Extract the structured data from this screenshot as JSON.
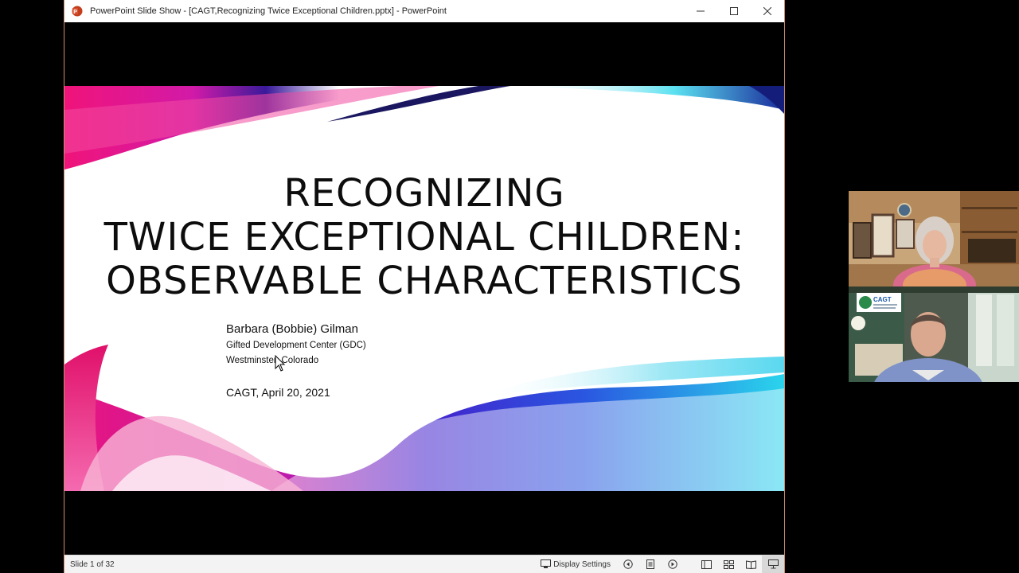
{
  "window": {
    "title": "PowerPoint Slide Show - [CAGT,Recognizing Twice Exceptional Children.pptx] - PowerPoint",
    "app_icon": "powerpoint-icon",
    "controls": [
      "minimize-icon",
      "maximize-icon",
      "close-icon"
    ]
  },
  "slide": {
    "title_lines": [
      "RECOGNIZING",
      "TWICE EXCEPTIONAL CHILDREN:",
      "OBSERVABLE CHARACTERISTICS"
    ],
    "presenter": "Barbara (Bobbie) Gilman",
    "organization": "Gifted Development Center (GDC)",
    "location": "Westminster, Colorado",
    "event": "CAGT, April 20, 2021",
    "colors": {
      "magenta": "#e8157f",
      "purple": "#6a22c8",
      "blue": "#2233cc",
      "cyan": "#22c8e8"
    }
  },
  "statusbar": {
    "slide_counter": "Slide 1 of 32",
    "display_settings": "Display Settings",
    "icons": [
      "previous-slide-icon",
      "slide-list-icon",
      "next-slide-icon",
      "normal-view-icon",
      "slide-sorter-icon",
      "reading-view-icon",
      "slideshow-view-icon"
    ]
  },
  "video": {
    "tiles": [
      {
        "name": "video-participant-1"
      },
      {
        "name": "video-participant-2",
        "overlay_logo": "CAGT"
      }
    ]
  }
}
